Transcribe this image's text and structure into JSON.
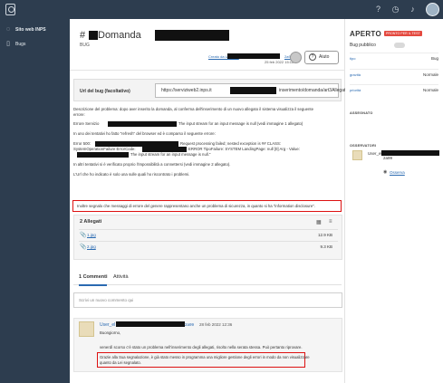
{
  "topbar": {
    "icons": [
      "help-icon",
      "clock-icon",
      "bell-icon"
    ]
  },
  "sidebar": {
    "items": [
      {
        "label": "Sito web INPS",
        "icon": "globe-icon"
      },
      {
        "label": "Bugs",
        "icon": "bookmark-icon"
      }
    ]
  },
  "issue": {
    "hash": "#",
    "title": "Domanda",
    "subtitle": "BUG",
    "creator_prefix": "Creato da User_fat",
    "creator_suffix": "2a99",
    "date": "25 feb 2022 15:11",
    "help_label": "Aiuto"
  },
  "url_field": {
    "label": "Url del bug (facoltativo)",
    "value_prefix": "https://serviziweb2.inps.it",
    "value_suffix": "inserimento/domanda/art3Allegato"
  },
  "description": {
    "line1": "Descrizione del problema: dopo aver inserito la domanda, al conferma dell'inserimento di un nuovo allegato il sistema visualizza il seguente",
    "line1b": "errore:",
    "line2a": "Errore Servizio",
    "line2b": "The input stream for an input message is null (vedi immagine 1 allegato)",
    "line3": "In uno dei tentativi ho fatto \"refresh\" del browser ed è comparso il seguente errore:",
    "line4a": "Error 500:",
    "line4b": "Request processing failed; nested exception is ## CLASS:",
    "line5a": "SystemOperationFailure ErrorCode:",
    "line5b": "ERROR TipoFailure: SYSTEM LandingPage: null [0] Arg - Value:",
    "line6": "The input stream for an input message is null.\"",
    "line7": "In altri tentativi si è verificato proprio l'impossibilità a connettersi (vedi immagine 2 allegato).",
    "line8": "L'Url che ho indicato è solo una sulle quali ho riscontrato i problemi.",
    "highlight": "Inoltre segnalo che messaggi di errore del genere rappresentano anche un problema di sicurezza, in quanto si ha \"information disclosure\"."
  },
  "attachments": {
    "header": "2 Allegati",
    "items": [
      {
        "name": "1.jpg",
        "size": "12.9 KB"
      },
      {
        "name": "2.jpg",
        "size": "9.3 KB"
      }
    ]
  },
  "tabs": [
    {
      "label": "1 Commenti",
      "active": true
    },
    {
      "label": "Attività",
      "active": false
    }
  ],
  "new_comment": {
    "placeholder": "Scrivi un nuovo commento qui"
  },
  "comment": {
    "author_prefix": "User_el",
    "author_suffix": "2a99",
    "date": "28 feb 2022 12:36",
    "greeting": "Buongiorno,",
    "line1": "venerdì scorso c'è stato un problema nell'inserimento degli allegati, risolto nella serata stessa. Può pertanto riprovare.",
    "hl_line1": "Grazie alla Sua segnalazione, è già stato messo in programma una migliore gestione degli errori in modo da non visualizzare",
    "hl_line2": "quanto da Lei segnalato."
  },
  "right_panel": {
    "status": "APERTO",
    "badge": "PRONTO PER IL TEST",
    "public_label": "Bug pubblico",
    "fields": [
      {
        "key": "tipo",
        "value": "Bug"
      },
      {
        "key": "gravità",
        "value": "Normale"
      },
      {
        "key": "priorità",
        "value": "Normale"
      }
    ],
    "assigned_label": "ASSEGNATO",
    "observers_label": "OSSERVATORI",
    "observer_prefix": "User_el",
    "observer_suffix": "2a99",
    "watch_label": "Osserva"
  },
  "colors": {
    "nav_bg": "#2d3d4f",
    "link": "#2a6ab1",
    "highlight_border": "#d11111",
    "badge": "#e4493f"
  }
}
